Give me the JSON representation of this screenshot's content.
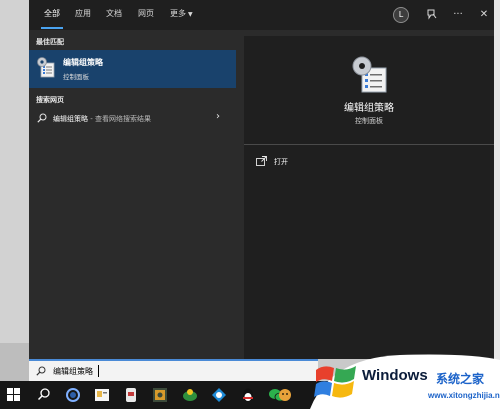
{
  "tabs": [
    {
      "label": "全部",
      "active": true
    },
    {
      "label": "应用",
      "active": false
    },
    {
      "label": "文档",
      "active": false
    },
    {
      "label": "网页",
      "active": false
    },
    {
      "label": "更多",
      "active": false
    }
  ],
  "top_actions": {
    "avatar_letter": "L",
    "more_glyph": "···",
    "close_glyph": "✕"
  },
  "best_match": {
    "section_title": "最佳匹配",
    "name": "编辑组策略",
    "subtitle": "控制面板"
  },
  "web_search": {
    "section_title": "搜索网页",
    "query": "编辑组策略",
    "suffix": " - 查看网络搜索结果"
  },
  "preview": {
    "name": "编辑组策略",
    "subtitle": "控制面板",
    "action_label": "打开"
  },
  "search_box": {
    "value": "编辑组策略"
  },
  "taskbar_icons": [
    "windows-start",
    "search",
    "cortana",
    "file-explorer",
    "app-1",
    "app-2",
    "app-3",
    "app-4",
    "qq",
    "wechat",
    "app-5"
  ],
  "watermark": {
    "brand": "Windows",
    "cn": "系统之家",
    "url": "www.xitongzhijia.net"
  },
  "colors": {
    "accent": "#4aa3f0",
    "selected": "#19426c",
    "panel": "#2b2b2b",
    "preview": "#1f1f1f"
  }
}
